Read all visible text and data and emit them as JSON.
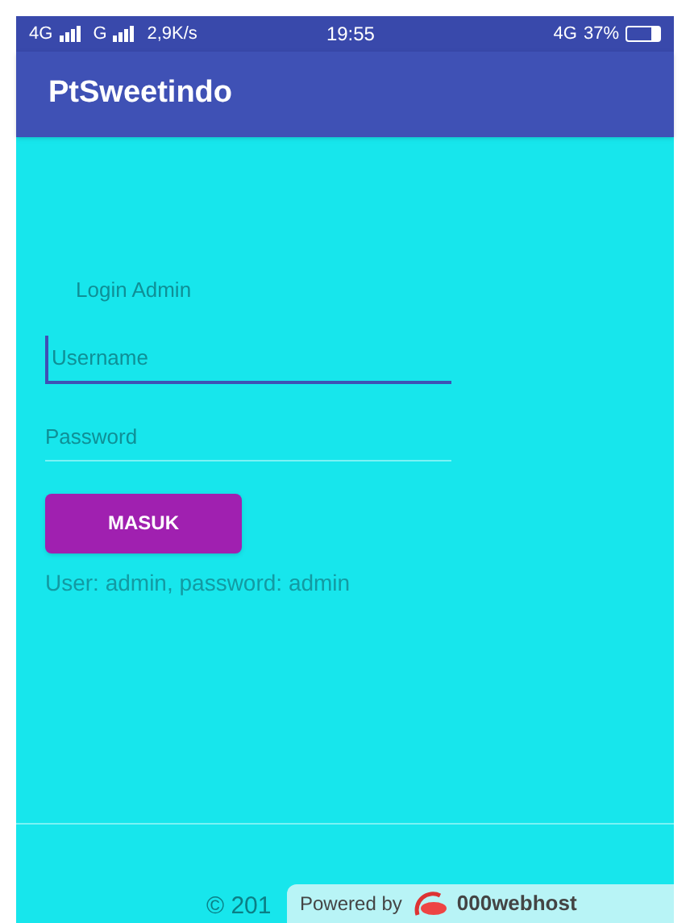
{
  "status_bar": {
    "network_1": "4G",
    "network_2": "G",
    "speed": "2,9K/s",
    "time": "19:55",
    "network_3": "4G",
    "battery": "37%"
  },
  "app_bar": {
    "title": "PtSweetindo"
  },
  "form": {
    "heading": "Login Admin",
    "fields": [
      {
        "placeholder": "Username",
        "focused": true
      },
      {
        "placeholder": "Password",
        "focused": false
      }
    ],
    "button": "MASUK",
    "hint": "User: admin, password: admin"
  },
  "footer": {
    "copyright": "© 201"
  },
  "badge": {
    "label": "Powered by",
    "brand": "000webhost"
  }
}
